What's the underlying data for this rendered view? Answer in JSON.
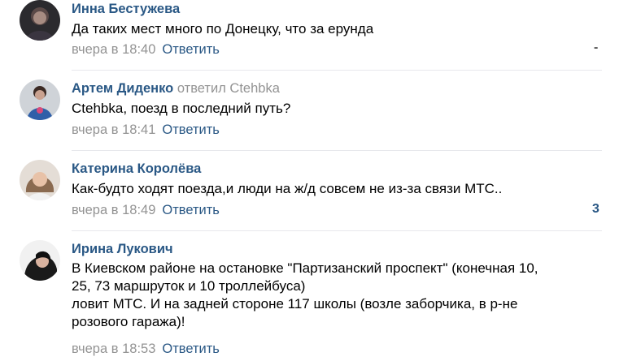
{
  "comments": [
    {
      "author": "Инна Бестужева",
      "replied": "",
      "reply_to": "",
      "lines": [
        "Да таких мест много по Донецку, что за ерунда"
      ],
      "time": "вчера в 18:40",
      "reply_label": "Ответить",
      "side": "-"
    },
    {
      "author": "Артем Диденко",
      "replied": "ответил",
      "reply_to": "Ctehbka",
      "lines": [
        "Ctehbka, поезд в последний путь?"
      ],
      "time": "вчера в 18:41",
      "reply_label": "Ответить",
      "side": ""
    },
    {
      "author": "Катерина Королёва",
      "replied": "",
      "reply_to": "",
      "lines": [
        "Как-будто ходят поезда,и люди на ж/д совсем не из-за связи МТС.."
      ],
      "time": "вчера в 18:49",
      "reply_label": "Ответить",
      "side": "3"
    },
    {
      "author": "Ирина Лукович",
      "replied": "",
      "reply_to": "",
      "lines": [
        "В Киевском районе на остановке \"Партизанский проспект\" (конечная 10,",
        "25, 73 маршруток и 10 троллейбуса)",
        "ловит МТС. И на задней стороне 117 школы (возле заборчика, в р-не",
        "розового гаража)!"
      ],
      "time": "вчера в 18:53",
      "reply_label": "Ответить",
      "side": ""
    }
  ],
  "colors": {
    "link": "#2a5885",
    "muted": "#939393",
    "divider": "#e7e8ec"
  }
}
